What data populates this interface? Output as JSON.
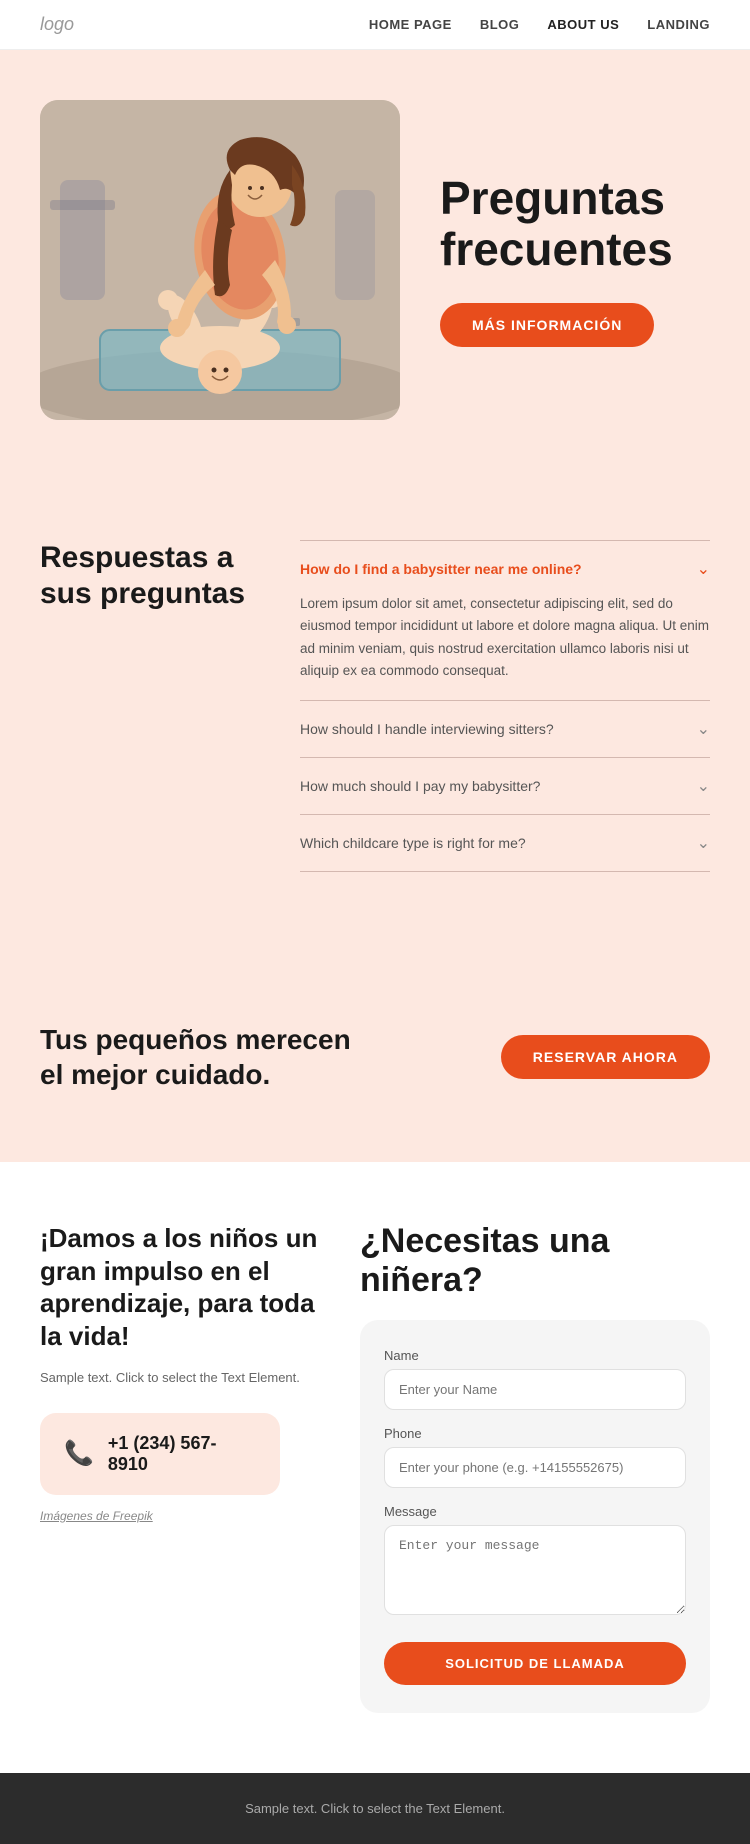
{
  "nav": {
    "logo": "logo",
    "links": [
      {
        "label": "HOME PAGE",
        "active": false
      },
      {
        "label": "BLOG",
        "active": false
      },
      {
        "label": "ABOUT US",
        "active": true
      },
      {
        "label": "LANDING",
        "active": false
      }
    ]
  },
  "hero": {
    "title": "Preguntas frecuentes",
    "cta_label": "MÁS INFORMACIÓN"
  },
  "faq": {
    "section_title": "Respuestas a sus preguntas",
    "items": [
      {
        "question": "How do I find a babysitter near me online?",
        "open": true,
        "answer": "Lorem ipsum dolor sit amet, consectetur adipiscing elit, sed do eiusmod tempor incididunt ut labore et dolore magna aliqua. Ut enim ad minim veniam, quis nostrud exercitation ullamco laboris nisi ut aliquip ex ea commodo consequat."
      },
      {
        "question": "How should I handle interviewing sitters?",
        "open": false,
        "answer": ""
      },
      {
        "question": "How much should I pay my babysitter?",
        "open": false,
        "answer": ""
      },
      {
        "question": "Which childcare type is right for me?",
        "open": false,
        "answer": ""
      }
    ]
  },
  "cta": {
    "title": "Tus pequeños merecen el mejor cuidado.",
    "button_label": "RESERVAR AHORA"
  },
  "contact": {
    "left_title": "¡Damos a los niños un gran impulso en el aprendizaje, para toda la vida!",
    "left_desc": "Sample text. Click to select the Text Element.",
    "phone": "+1 (234) 567-8910",
    "freepik": "Imágenes de Freepik",
    "form_title": "¿Necesitas una niñera?",
    "fields": {
      "name_label": "Name",
      "name_placeholder": "Enter your Name",
      "phone_label": "Phone",
      "phone_placeholder": "Enter your phone (e.g. +14155552675)",
      "message_label": "Message",
      "message_placeholder": "Enter your message"
    },
    "submit_label": "SOLICITUD DE LLAMADA"
  },
  "footer": {
    "text": "Sample text. Click to select the Text Element."
  }
}
